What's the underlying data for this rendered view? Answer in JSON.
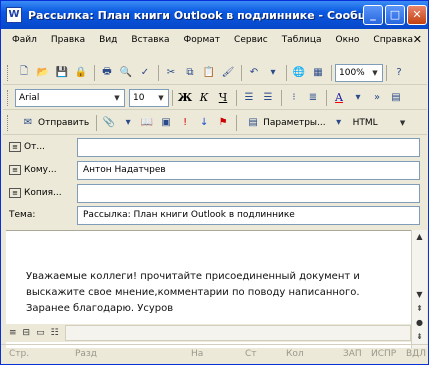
{
  "window": {
    "title": "Рассылка: План книги Outlook в подлиннике - Сообщен...",
    "app_icon": "W",
    "controls": {
      "minimize": "_",
      "maximize": "□",
      "close": "✕"
    }
  },
  "menubar": {
    "items": [
      "Файл",
      "Правка",
      "Вид",
      "Вставка",
      "Формат",
      "Сервис",
      "Таблица",
      "Окно",
      "Справка"
    ],
    "close": "✕"
  },
  "toolbar_standard": {
    "icons": [
      "new-doc-icon",
      "open-icon",
      "save-icon",
      "permission-icon",
      "print-icon",
      "print-preview-icon",
      "spelling-icon",
      "cut-icon",
      "copy-icon",
      "paste-icon",
      "format-painter-icon",
      "undo-icon",
      "hyperlink-icon",
      "tables-icon"
    ],
    "zoom": "100%",
    "help": "?"
  },
  "toolbar_format": {
    "font": "Arial",
    "size": "10",
    "bold": "Ж",
    "italic": "К",
    "underline": "Ч",
    "font_color": "A"
  },
  "toolbar_email": {
    "send": "Отправить",
    "params": "Параметры...",
    "format": "HTML"
  },
  "header": {
    "from_label": "От...",
    "to_label": "Кому...",
    "to_value": "Антон Надатчрев",
    "cc_label": "Копия...",
    "subject_label": "Тема:",
    "subject_value": "Рассылка: План книги Outlook в подлиннике"
  },
  "body": {
    "line1": "Уважаемые коллеги! прочитайте присоединенный документ и",
    "line2": "выскажите свое мнение,комментарии по поводу написанного.",
    "line3": "Заранее благодарю. Усуров"
  },
  "status": {
    "page": "Стр.",
    "section": "Разд",
    "at": "На",
    "line": "Ст",
    "col": "Кол",
    "rec": "ЗАП",
    "trk": "ИСПР",
    "ext": "ВДЛ"
  }
}
